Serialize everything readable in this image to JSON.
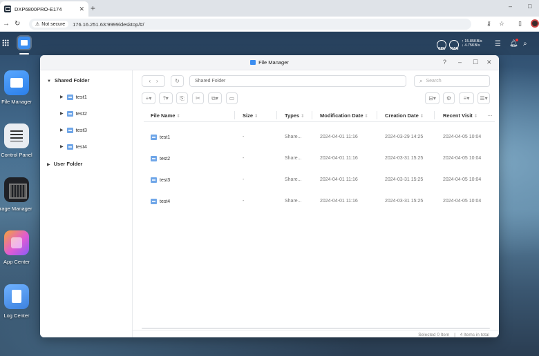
{
  "browser": {
    "tab_title": "DXP6800PRO-E174",
    "tab_close": "✕",
    "new_tab": "+",
    "security_label": "Not secure",
    "url": "176.16.251.63:9999/desktop/#/",
    "win_min": "–",
    "win_max": "□"
  },
  "taskbar": {
    "cpu_label": "CPU",
    "ram_label": "RAM",
    "upload_speed": "↑ 15.85KB/s",
    "download_speed": "↓ 4.75KB/s"
  },
  "desktop_icons": [
    {
      "label": "File Manager"
    },
    {
      "label": "Control Panel"
    },
    {
      "label": "torage Manager"
    },
    {
      "label": "App Center"
    },
    {
      "label": "Log Center"
    }
  ],
  "window": {
    "title": "File Manager",
    "help": "?",
    "minimize": "–",
    "maximize": "☐",
    "close": "✕"
  },
  "sidebar": {
    "shared_folder": "Shared Folder",
    "shared_items": [
      "test1",
      "test2",
      "test3",
      "test4"
    ],
    "user_folder": "User Folder"
  },
  "toolbar": {
    "breadcrumb": "Shared Folder",
    "search_placeholder": "Search"
  },
  "table": {
    "columns": [
      "File Name",
      "Size",
      "Types",
      "Modification Date",
      "Creation Date",
      "Recent Visit"
    ],
    "sort_glyph": "⇕",
    "rows": [
      {
        "name": "test1",
        "size": "-",
        "type": "Share...",
        "modified": "2024-04-01 11:16",
        "created": "2024-03-29 14:25",
        "visited": "2024-04-05 10:04"
      },
      {
        "name": "test2",
        "size": "-",
        "type": "Share...",
        "modified": "2024-04-01 11:16",
        "created": "2024-03-31 15:25",
        "visited": "2024-04-05 10:04"
      },
      {
        "name": "test3",
        "size": "-",
        "type": "Share...",
        "modified": "2024-04-01 11:16",
        "created": "2024-03-31 15:25",
        "visited": "2024-04-05 10:04"
      },
      {
        "name": "test4",
        "size": "-",
        "type": "Share...",
        "modified": "2024-04-01 11:16",
        "created": "2024-03-31 15:25",
        "visited": "2024-04-05 10:04"
      }
    ]
  },
  "status": {
    "selected": "Selected 0 Item",
    "divider": "|",
    "total": "4 Items in total"
  }
}
